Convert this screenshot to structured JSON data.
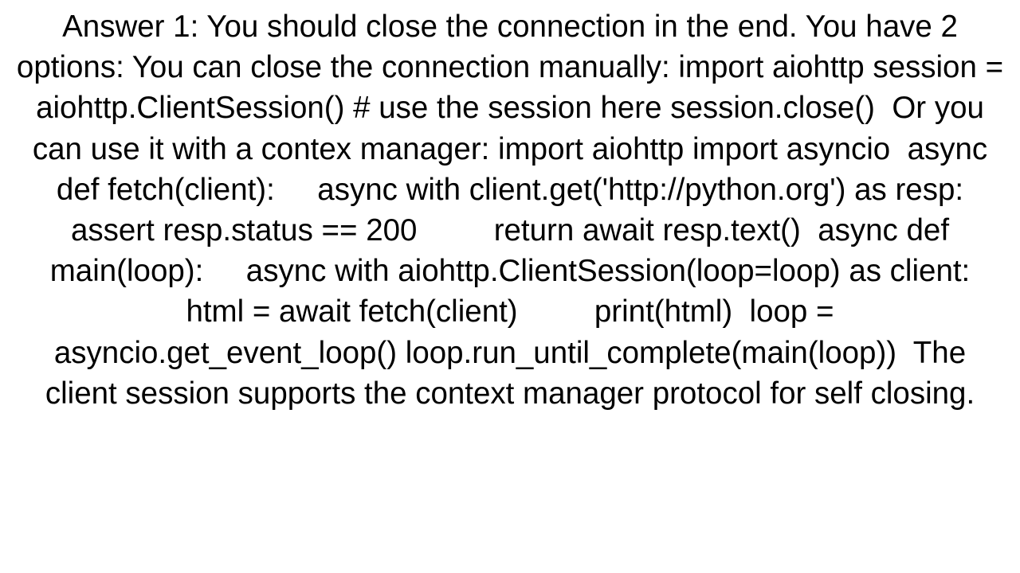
{
  "answer": {
    "text": "Answer 1: You should close the connection in the end. You have 2 options: You can close the connection manually: import aiohttp session = aiohttp.ClientSession() # use the session here session.close()  Or you can use it with a contex manager: import aiohttp import asyncio  async def fetch(client):     async with client.get('http://python.org') as resp:         assert resp.status == 200         return await resp.text()  async def main(loop):     async with aiohttp.ClientSession(loop=loop) as client:         html = await fetch(client)         print(html)  loop = asyncio.get_event_loop() loop.run_until_complete(main(loop))  The client session supports the context manager protocol for self closing."
  }
}
